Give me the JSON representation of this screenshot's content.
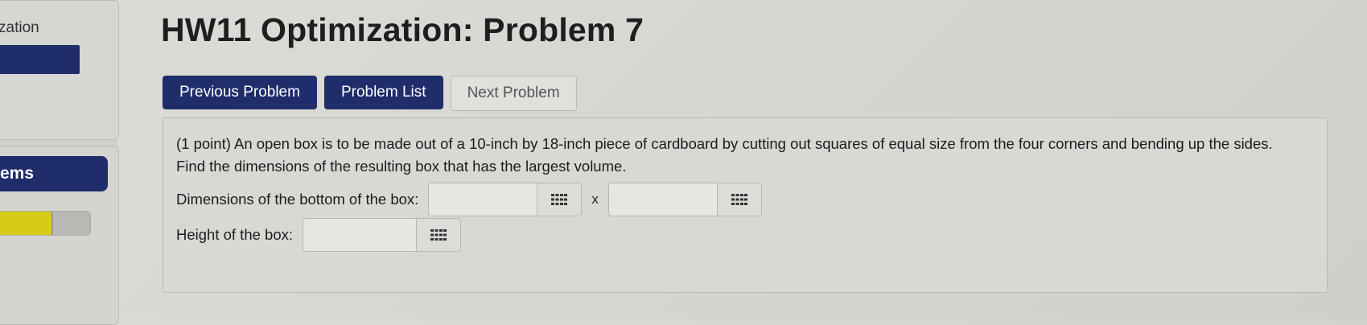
{
  "sidebar": {
    "title": "zation",
    "nav_item": "ems",
    "progress_fraction": 0.58
  },
  "page_title": "HW11 Optimization: Problem 7",
  "nav": {
    "previous": "Previous Problem",
    "list": "Problem List",
    "next": "Next Problem"
  },
  "problem": {
    "text": "(1 point) An open box is to be made out of a 10-inch by 18-inch piece of cardboard by cutting out squares of equal size from the four corners and bending up the sides. Find the dimensions of the resulting box that has the largest volume.",
    "dims_label": "Dimensions of the bottom of the box:",
    "times_symbol": "x",
    "height_label": "Height of the box:",
    "dim1_value": "",
    "dim2_value": "",
    "height_value": ""
  },
  "icons": {
    "keypad": "grid-keypad-icon"
  },
  "colors": {
    "navy": "#1f2d6b",
    "progress": "#d6cc18"
  }
}
